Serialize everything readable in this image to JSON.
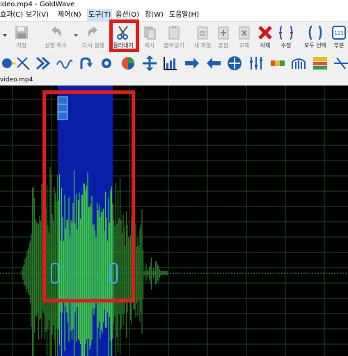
{
  "window": {
    "title": "ideo.mp4 - GoldWave"
  },
  "menu": [
    {
      "label": "효과(C)"
    },
    {
      "label": "보기(V)"
    },
    {
      "label": "제어(N)"
    },
    {
      "label": "도구(T)"
    },
    {
      "label": "옵션(O)"
    },
    {
      "label": "창(W)"
    },
    {
      "label": "도움말(H)"
    }
  ],
  "toolbar": {
    "save": "저장",
    "undo": "실행 취소",
    "redo": "다시 실행",
    "cut": "잘라내기",
    "copy": "복사",
    "paste": "붙여넣기",
    "new_file": "새 파일",
    "mix": "혼합",
    "replace": "교체",
    "delete": "삭제",
    "trim": "수정",
    "select_all": "모두 선택",
    "part": "부분"
  },
  "tab": {
    "label": "video.mp4"
  },
  "colors": {
    "selection": "#0a1fa8",
    "waveform_selected": "#3fcf3f",
    "waveform": "#2a7a2a",
    "grid": "#1e4d1e",
    "highlight_box": "#e21b1b"
  },
  "icons": {
    "toolbar2": [
      "play-icon",
      "marker-icon",
      "forward-icon",
      "wave-icon",
      "loop-icon",
      "gear-icon",
      "color-wheel-icon",
      "expand-icon",
      "equalizer-icon",
      "arrow-right-icon",
      "arrow-left-icon",
      "crosshair-icon",
      "mixer-icon",
      "spectrum-icon",
      "pipe-organ-icon",
      "channel-icon",
      "filter-icon"
    ]
  }
}
